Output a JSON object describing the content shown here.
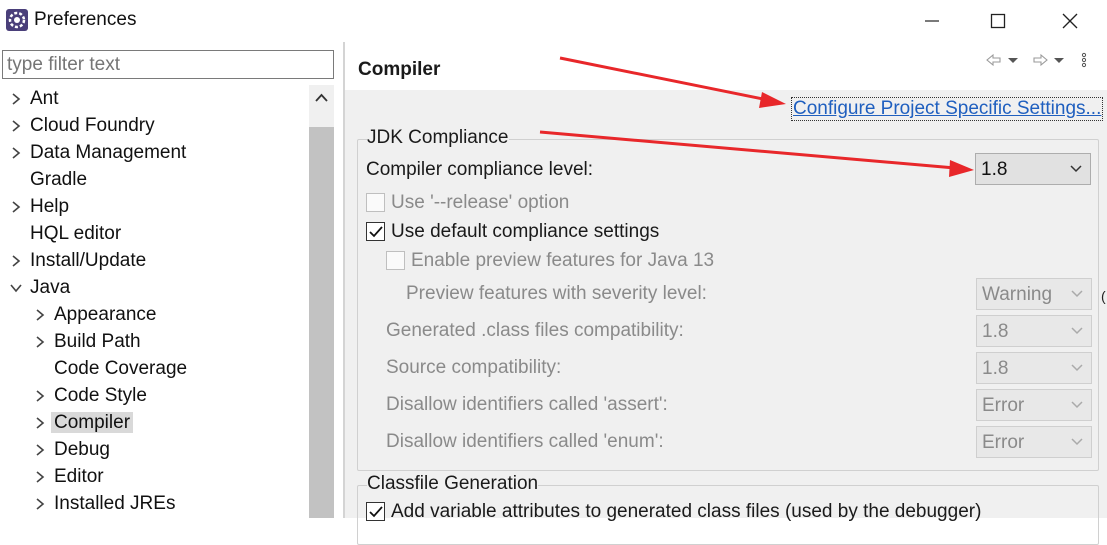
{
  "window": {
    "title": "Preferences",
    "app_icon": "eclipse-gear-icon",
    "controls": [
      "minimize-icon",
      "maximize-icon",
      "close-icon"
    ]
  },
  "filter": {
    "placeholder": "type filter text"
  },
  "tree": {
    "items": [
      {
        "label": "Ant",
        "chevron": "right"
      },
      {
        "label": "Cloud Foundry",
        "chevron": "right"
      },
      {
        "label": "Data Management",
        "chevron": "right"
      },
      {
        "label": "Gradle",
        "chevron": "none"
      },
      {
        "label": "Help",
        "chevron": "right"
      },
      {
        "label": "HQL editor",
        "chevron": "none"
      },
      {
        "label": "Install/Update",
        "chevron": "right"
      },
      {
        "label": "Java",
        "chevron": "down"
      },
      {
        "label": "Appearance",
        "chevron": "right"
      },
      {
        "label": "Build Path",
        "chevron": "right"
      },
      {
        "label": "Code Coverage",
        "chevron": "none"
      },
      {
        "label": "Code Style",
        "chevron": "right"
      },
      {
        "label": "Compiler",
        "chevron": "right",
        "selected": true
      },
      {
        "label": "Debug",
        "chevron": "right"
      },
      {
        "label": "Editor",
        "chevron": "right"
      },
      {
        "label": "Installed JREs",
        "chevron": "right"
      }
    ]
  },
  "page": {
    "title": "Compiler",
    "nav_icons": [
      "back-arrow-icon",
      "back-menu-chevron-icon",
      "forward-arrow-icon",
      "forward-menu-chevron-icon",
      "view-menu-icon"
    ],
    "configure_link": "Configure Project Specific Settings...",
    "jdk_group": {
      "label": "JDK Compliance",
      "compliance_level_label": "Compiler compliance level:",
      "compliance_level_value": "1.8",
      "release_option_label": "Use '--release' option",
      "release_option_checked": false,
      "default_settings_label": "Use default compliance settings",
      "default_settings_checked": true,
      "preview_label": "Enable preview features for Java 13",
      "preview_checked": false,
      "preview_severity_label": "Preview features with severity level:",
      "preview_severity_value": "Warning",
      "class_compat_label": "Generated .class files compatibility:",
      "class_compat_value": "1.8",
      "source_compat_label": "Source compatibility:",
      "source_compat_value": "1.8",
      "assert_label": "Disallow identifiers called 'assert':",
      "assert_value": "Error",
      "enum_label": "Disallow identifiers called 'enum':",
      "enum_value": "Error"
    },
    "classfile_group": {
      "label": "Classfile Generation",
      "variable_attrs_label": "Add variable attributes to generated class files (used by the debugger)",
      "variable_attrs_checked": true
    }
  },
  "annotation_color": "#e8272a"
}
